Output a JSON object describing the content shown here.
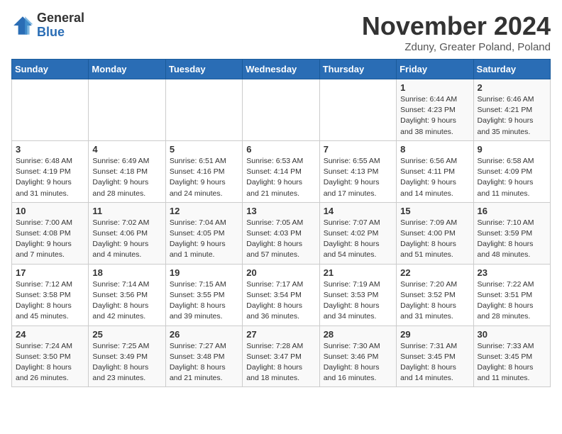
{
  "logo": {
    "general": "General",
    "blue": "Blue"
  },
  "title": "November 2024",
  "location": "Zduny, Greater Poland, Poland",
  "days_of_week": [
    "Sunday",
    "Monday",
    "Tuesday",
    "Wednesday",
    "Thursday",
    "Friday",
    "Saturday"
  ],
  "weeks": [
    [
      {
        "day": "",
        "info": ""
      },
      {
        "day": "",
        "info": ""
      },
      {
        "day": "",
        "info": ""
      },
      {
        "day": "",
        "info": ""
      },
      {
        "day": "",
        "info": ""
      },
      {
        "day": "1",
        "info": "Sunrise: 6:44 AM\nSunset: 4:23 PM\nDaylight: 9 hours\nand 38 minutes."
      },
      {
        "day": "2",
        "info": "Sunrise: 6:46 AM\nSunset: 4:21 PM\nDaylight: 9 hours\nand 35 minutes."
      }
    ],
    [
      {
        "day": "3",
        "info": "Sunrise: 6:48 AM\nSunset: 4:19 PM\nDaylight: 9 hours\nand 31 minutes."
      },
      {
        "day": "4",
        "info": "Sunrise: 6:49 AM\nSunset: 4:18 PM\nDaylight: 9 hours\nand 28 minutes."
      },
      {
        "day": "5",
        "info": "Sunrise: 6:51 AM\nSunset: 4:16 PM\nDaylight: 9 hours\nand 24 minutes."
      },
      {
        "day": "6",
        "info": "Sunrise: 6:53 AM\nSunset: 4:14 PM\nDaylight: 9 hours\nand 21 minutes."
      },
      {
        "day": "7",
        "info": "Sunrise: 6:55 AM\nSunset: 4:13 PM\nDaylight: 9 hours\nand 17 minutes."
      },
      {
        "day": "8",
        "info": "Sunrise: 6:56 AM\nSunset: 4:11 PM\nDaylight: 9 hours\nand 14 minutes."
      },
      {
        "day": "9",
        "info": "Sunrise: 6:58 AM\nSunset: 4:09 PM\nDaylight: 9 hours\nand 11 minutes."
      }
    ],
    [
      {
        "day": "10",
        "info": "Sunrise: 7:00 AM\nSunset: 4:08 PM\nDaylight: 9 hours\nand 7 minutes."
      },
      {
        "day": "11",
        "info": "Sunrise: 7:02 AM\nSunset: 4:06 PM\nDaylight: 9 hours\nand 4 minutes."
      },
      {
        "day": "12",
        "info": "Sunrise: 7:04 AM\nSunset: 4:05 PM\nDaylight: 9 hours\nand 1 minute."
      },
      {
        "day": "13",
        "info": "Sunrise: 7:05 AM\nSunset: 4:03 PM\nDaylight: 8 hours\nand 57 minutes."
      },
      {
        "day": "14",
        "info": "Sunrise: 7:07 AM\nSunset: 4:02 PM\nDaylight: 8 hours\nand 54 minutes."
      },
      {
        "day": "15",
        "info": "Sunrise: 7:09 AM\nSunset: 4:00 PM\nDaylight: 8 hours\nand 51 minutes."
      },
      {
        "day": "16",
        "info": "Sunrise: 7:10 AM\nSunset: 3:59 PM\nDaylight: 8 hours\nand 48 minutes."
      }
    ],
    [
      {
        "day": "17",
        "info": "Sunrise: 7:12 AM\nSunset: 3:58 PM\nDaylight: 8 hours\nand 45 minutes."
      },
      {
        "day": "18",
        "info": "Sunrise: 7:14 AM\nSunset: 3:56 PM\nDaylight: 8 hours\nand 42 minutes."
      },
      {
        "day": "19",
        "info": "Sunrise: 7:15 AM\nSunset: 3:55 PM\nDaylight: 8 hours\nand 39 minutes."
      },
      {
        "day": "20",
        "info": "Sunrise: 7:17 AM\nSunset: 3:54 PM\nDaylight: 8 hours\nand 36 minutes."
      },
      {
        "day": "21",
        "info": "Sunrise: 7:19 AM\nSunset: 3:53 PM\nDaylight: 8 hours\nand 34 minutes."
      },
      {
        "day": "22",
        "info": "Sunrise: 7:20 AM\nSunset: 3:52 PM\nDaylight: 8 hours\nand 31 minutes."
      },
      {
        "day": "23",
        "info": "Sunrise: 7:22 AM\nSunset: 3:51 PM\nDaylight: 8 hours\nand 28 minutes."
      }
    ],
    [
      {
        "day": "24",
        "info": "Sunrise: 7:24 AM\nSunset: 3:50 PM\nDaylight: 8 hours\nand 26 minutes."
      },
      {
        "day": "25",
        "info": "Sunrise: 7:25 AM\nSunset: 3:49 PM\nDaylight: 8 hours\nand 23 minutes."
      },
      {
        "day": "26",
        "info": "Sunrise: 7:27 AM\nSunset: 3:48 PM\nDaylight: 8 hours\nand 21 minutes."
      },
      {
        "day": "27",
        "info": "Sunrise: 7:28 AM\nSunset: 3:47 PM\nDaylight: 8 hours\nand 18 minutes."
      },
      {
        "day": "28",
        "info": "Sunrise: 7:30 AM\nSunset: 3:46 PM\nDaylight: 8 hours\nand 16 minutes."
      },
      {
        "day": "29",
        "info": "Sunrise: 7:31 AM\nSunset: 3:45 PM\nDaylight: 8 hours\nand 14 minutes."
      },
      {
        "day": "30",
        "info": "Sunrise: 7:33 AM\nSunset: 3:45 PM\nDaylight: 8 hours\nand 11 minutes."
      }
    ]
  ]
}
